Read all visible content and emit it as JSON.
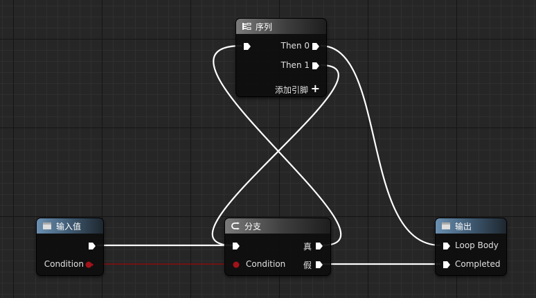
{
  "colors": {
    "exec_wire": "#ffffff",
    "bool_wire": "#8b0d0d",
    "bool_pin": "#a3121a",
    "header_gray": "#5a5a5a",
    "header_blue": "#4a6a86"
  },
  "sequence_node": {
    "title": "序列",
    "icon": "sequence-icon",
    "outputs": [
      "Then 0",
      "Then 1"
    ],
    "add_pin_label": "添加引脚"
  },
  "input_node": {
    "title": "输入值",
    "icon": "tunnel-icon",
    "outputs": [
      "",
      "Condition"
    ]
  },
  "branch_node": {
    "title": "分支",
    "icon": "branch-icon",
    "inputs": [
      "",
      "Condition"
    ],
    "outputs": [
      "真",
      "假"
    ]
  },
  "output_node": {
    "title": "输出",
    "icon": "tunnel-icon",
    "inputs": [
      "Loop Body",
      "Completed"
    ]
  }
}
